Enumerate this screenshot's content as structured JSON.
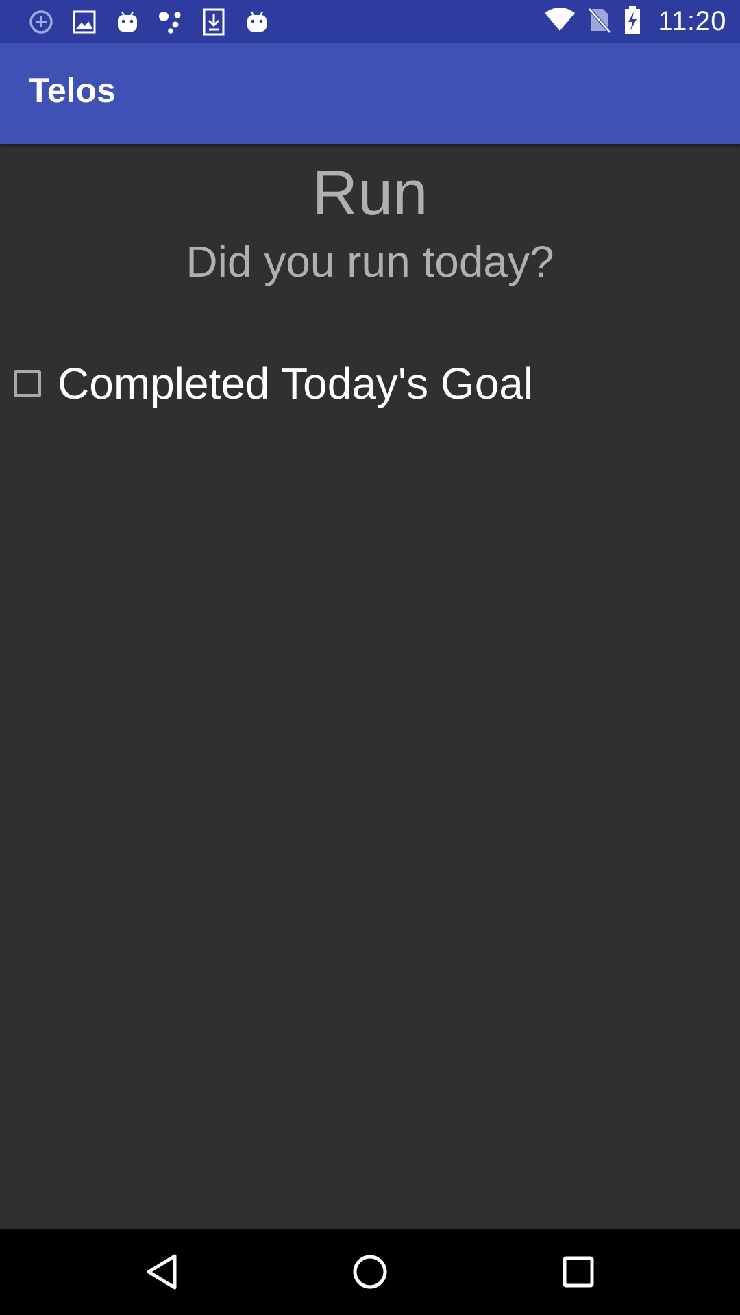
{
  "status_bar": {
    "time": "11:20",
    "left_icons": [
      "add-circle-icon",
      "image-icon",
      "android-icon",
      "assistant-icon",
      "download-icon",
      "android-icon"
    ],
    "right_icons": [
      "wifi-icon",
      "no-sim-icon",
      "battery-charging-icon"
    ]
  },
  "app_bar": {
    "title": "Telos"
  },
  "habit": {
    "title": "Run",
    "question": "Did you run today?",
    "goal_label": "Completed Today's Goal",
    "goal_checked": false
  },
  "nav_bar": {
    "buttons": [
      "back-icon",
      "home-icon",
      "recents-icon"
    ]
  },
  "colors": {
    "status_bar": "#2f3c9f",
    "app_bar": "#3f51b5",
    "background": "#303030",
    "secondary_text": "#b0b0b0"
  }
}
